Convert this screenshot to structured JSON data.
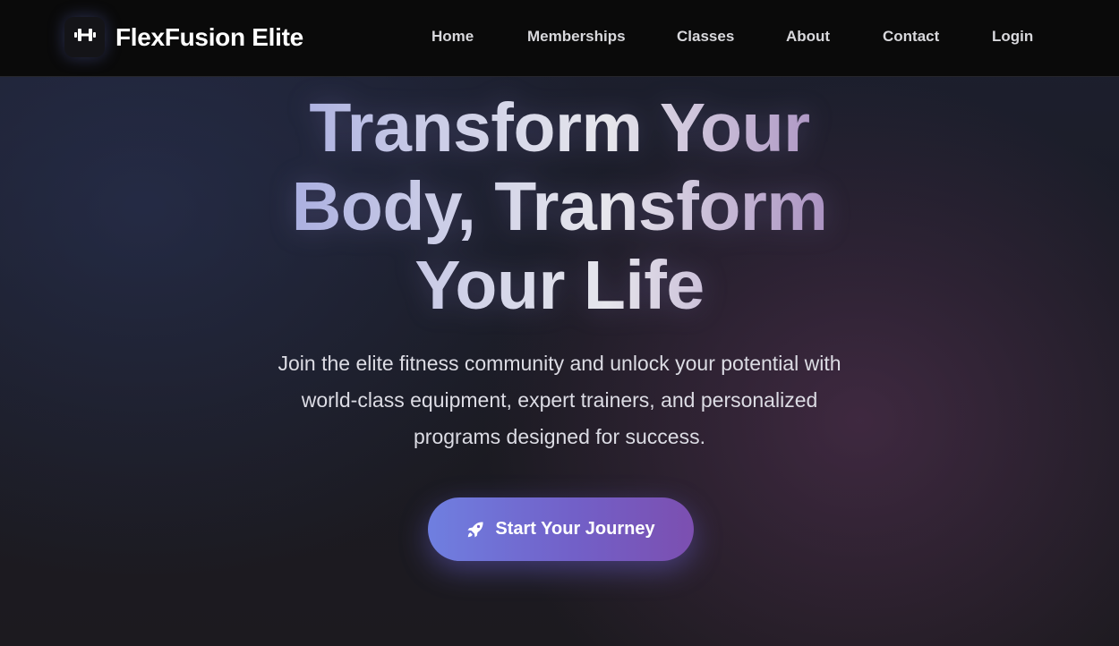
{
  "brand": {
    "name": "FlexFusion Elite",
    "logo_icon": "dumbbell-icon"
  },
  "nav": {
    "items": [
      {
        "label": "Home"
      },
      {
        "label": "Memberships"
      },
      {
        "label": "Classes"
      },
      {
        "label": "About"
      },
      {
        "label": "Contact"
      },
      {
        "label": "Login"
      }
    ]
  },
  "hero": {
    "headline_lines": [
      "Transform Your",
      "Body, Transform",
      "Your Life"
    ],
    "subtitle_lines": [
      "Join the elite fitness community and unlock your potential with",
      "world-class equipment, expert trainers, and personalized",
      "programs designed for success."
    ],
    "cta": {
      "label": "Start Your Journey",
      "icon": "rocket-icon"
    }
  },
  "colors": {
    "accent_start": "#6f7fe0",
    "accent_end": "#7c4fb0",
    "nav_bg": "#0a0a0a"
  }
}
